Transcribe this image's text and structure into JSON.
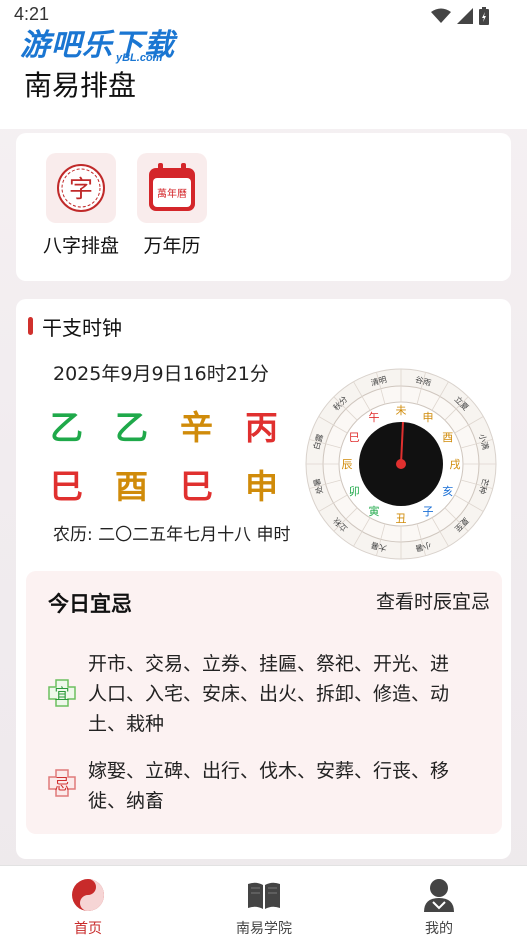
{
  "status_bar": {
    "time": "4:21"
  },
  "watermark": {
    "main": "游吧乐下载",
    "sub": "yBL.com"
  },
  "header": {
    "title": "南易排盘"
  },
  "tools": [
    {
      "label": "八字排盘",
      "icon": "bazi-icon",
      "glyph": "字"
    },
    {
      "label": "万年历",
      "icon": "calendar-icon",
      "glyph": "萬年曆"
    }
  ],
  "clock_section": {
    "title": "干支时钟",
    "datetime": "2025年9月9日16时21分",
    "stems": [
      "乙",
      "乙",
      "辛",
      "丙"
    ],
    "branches": [
      "巳",
      "酉",
      "巳",
      "申"
    ],
    "stem_colors": [
      "#1fa94a",
      "#1fa94a",
      "#d08b0a",
      "#e0302f"
    ],
    "branch_colors": [
      "#e0302f",
      "#d08b0a",
      "#e0302f",
      "#d08b0a"
    ],
    "lunar": "农历: 二〇二五年七月十八 申时",
    "dial_inner": [
      "申",
      "酉",
      "戌",
      "亥",
      "子",
      "丑",
      "寅",
      "卯",
      "辰",
      "巳",
      "午",
      "未"
    ],
    "dial_outer": [
      "清明",
      "谷雨",
      "立夏",
      "小满",
      "芒种",
      "夏至",
      "小暑",
      "大暑",
      "立秋",
      "处暑",
      "白露",
      "秋分"
    ]
  },
  "yiji": {
    "title": "今日宜忌",
    "link": "查看时辰宜忌",
    "yi_label": "宜",
    "ji_label": "忌",
    "yi_line1": "开市、交易、立券、挂匾、祭祀、开光、进",
    "yi_line2": "人口、入宅、安床、出火、拆卸、修造、动",
    "yi_line3": "土、栽种",
    "ji_line1": "嫁娶、立碑、出行、伐木、安葬、行丧、移",
    "ji_line2": "徙、纳畜"
  },
  "bottom_nav": [
    {
      "label": "首页",
      "icon": "yin-yang-icon",
      "active": true
    },
    {
      "label": "南易学院",
      "icon": "book-icon",
      "active": false
    },
    {
      "label": "我的",
      "icon": "user-icon",
      "active": false
    }
  ],
  "colors": {
    "accent": "#c82a2a",
    "green": "#1fa94a",
    "gold": "#d08b0a",
    "red": "#e0302f"
  }
}
